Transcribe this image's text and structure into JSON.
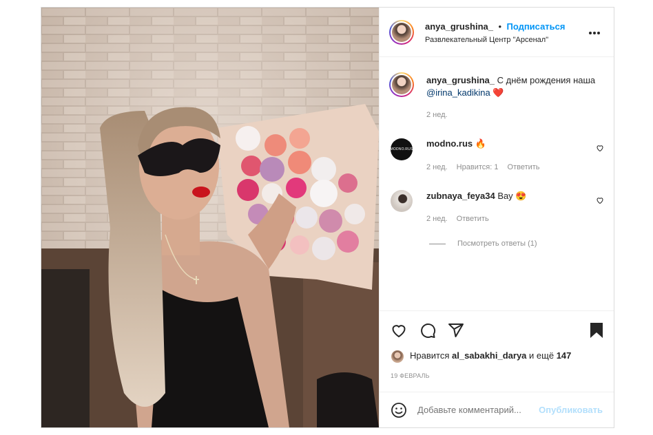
{
  "header": {
    "username": "anya_grushina_",
    "separator": "•",
    "follow_label": "Подписаться",
    "location": "Развлекательный Центр \"Арсенал\"",
    "more_icon": "more-horizontal-icon"
  },
  "caption": {
    "username": "anya_grushina_",
    "text": "С днём рождения наша",
    "mention": "@irina_kadikina",
    "emoji": "❤️",
    "time": "2 нед."
  },
  "comments": [
    {
      "username": "modno.rus",
      "text": "🔥",
      "time": "2 нед.",
      "likes": "Нравится: 1",
      "reply_label": "Ответить",
      "avatar_text": "MODNO.RUS"
    },
    {
      "username": "zubnaya_feya34",
      "text": "Вау 😍",
      "time": "2 нед.",
      "reply_label": "Ответить",
      "view_replies": "Посмотреть ответы (1)"
    }
  ],
  "actions": {
    "like_icon": "heart-outline-icon",
    "comment_icon": "comment-icon",
    "share_icon": "paper-plane-icon",
    "save_icon": "bookmark-filled-icon"
  },
  "likes": {
    "prefix": "Нравится",
    "user": "al_sabakhi_darya",
    "suffix": "и ещё",
    "count": "147"
  },
  "date": "19 ФЕВРАЛЬ",
  "add_comment": {
    "placeholder": "Добавьте комментарий...",
    "publish_label": "Опубликовать",
    "emoji_icon": "smiley-icon"
  },
  "colors": {
    "accent": "#0095f6",
    "text": "#262626",
    "muted": "#8e8e8e",
    "border": "#dbdbdb",
    "heart": "#ed4956"
  }
}
